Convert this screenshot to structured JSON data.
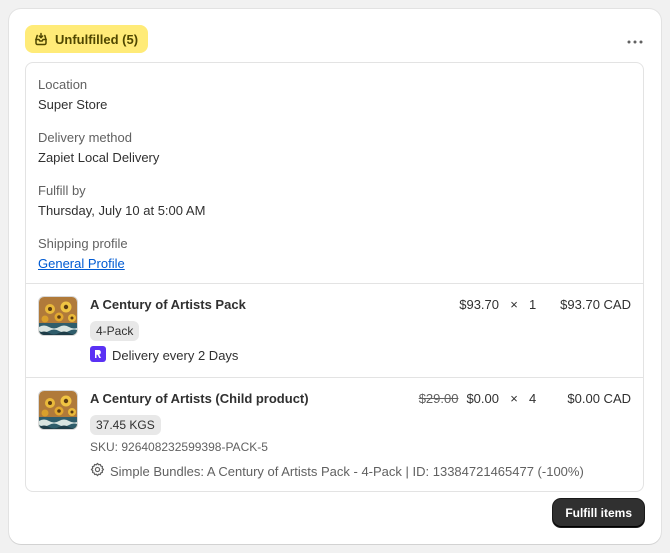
{
  "header": {
    "status_label": "Unfulfilled (5)",
    "status_icon": "fulfillment-box-icon",
    "badge_bg": "#ffeb78",
    "more_icon": "more-horizontal-icon"
  },
  "info": {
    "location_label": "Location",
    "location_value": "Super Store",
    "delivery_label": "Delivery method",
    "delivery_value": "Zapiet Local Delivery",
    "fulfill_by_label": "Fulfill by",
    "fulfill_by_value": "Thursday, July 10 at 5:00 AM",
    "shipping_label": "Shipping profile",
    "shipping_value": "General Profile"
  },
  "line_items": [
    {
      "title": "A Century of Artists Pack",
      "variant": "4-Pack",
      "subscription": "Delivery every 2 Days",
      "subscription_icon": "recharge-icon",
      "unit_price": "$93.70",
      "times": "×",
      "quantity": "1",
      "total": "$93.70 CAD"
    },
    {
      "title": "A Century of Artists (Child product)",
      "variant": "37.45 KGS",
      "sku": "SKU: 926408232599398-PACK-5",
      "bundle": "Simple Bundles: A Century of Artists Pack - 4-Pack | ID: 13384721465477 (-100%)",
      "bundle_icon": "gear-icon",
      "original_price": "$29.00",
      "unit_price": "$0.00",
      "times": "×",
      "quantity": "4",
      "total": "$0.00 CAD"
    }
  ],
  "actions": {
    "fulfill_label": "Fulfill items"
  }
}
